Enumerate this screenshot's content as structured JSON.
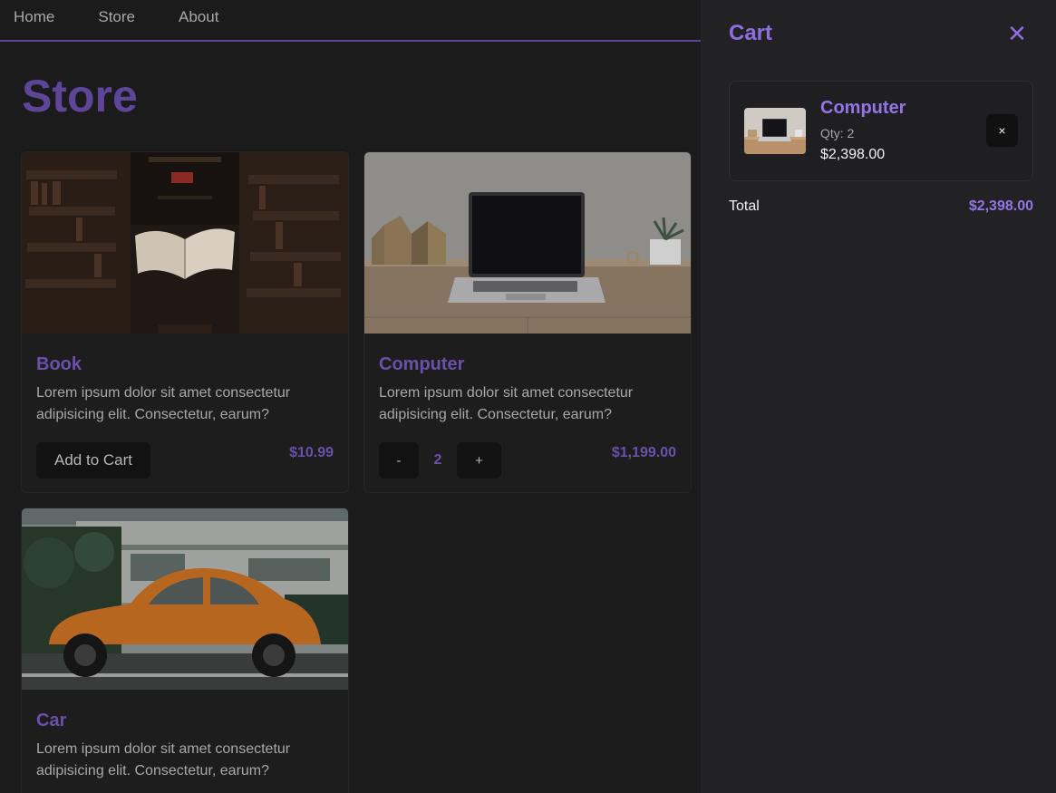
{
  "nav": {
    "items": [
      {
        "label": "Home"
      },
      {
        "label": "Store"
      },
      {
        "label": "About"
      }
    ]
  },
  "store": {
    "title": "Store",
    "products": [
      {
        "name": "Book",
        "description": "Lorem ipsum dolor sit amet consectetur adipisicing elit. Consectetur, earum?",
        "price": "$10.99",
        "action_label": "Add to Cart",
        "image": "library-book-photo"
      },
      {
        "name": "Computer",
        "description": "Lorem ipsum dolor sit amet consectetur adipisicing elit. Consectetur, earum?",
        "price": "$1,199.00",
        "quantity": "2",
        "decrement_label": "-",
        "increment_label": "+",
        "image": "laptop-on-desk-photo"
      },
      {
        "name": "Car",
        "description": "Lorem ipsum dolor sit amet consectetur adipisicing elit. Consectetur, earum?",
        "image": "orange-beetle-car-photo"
      }
    ]
  },
  "cart": {
    "title": "Cart",
    "close_icon": "close-icon",
    "items": [
      {
        "name": "Computer",
        "qty_text": "Qty: 2",
        "price": "$2,398.00",
        "remove_label": "×"
      }
    ],
    "total_label": "Total",
    "total_value": "$2,398.00"
  },
  "colors": {
    "accent": "#9574e6",
    "accent_dimmed": "#6a50a9",
    "background": "#1b1b1c",
    "panel": "#222224"
  }
}
